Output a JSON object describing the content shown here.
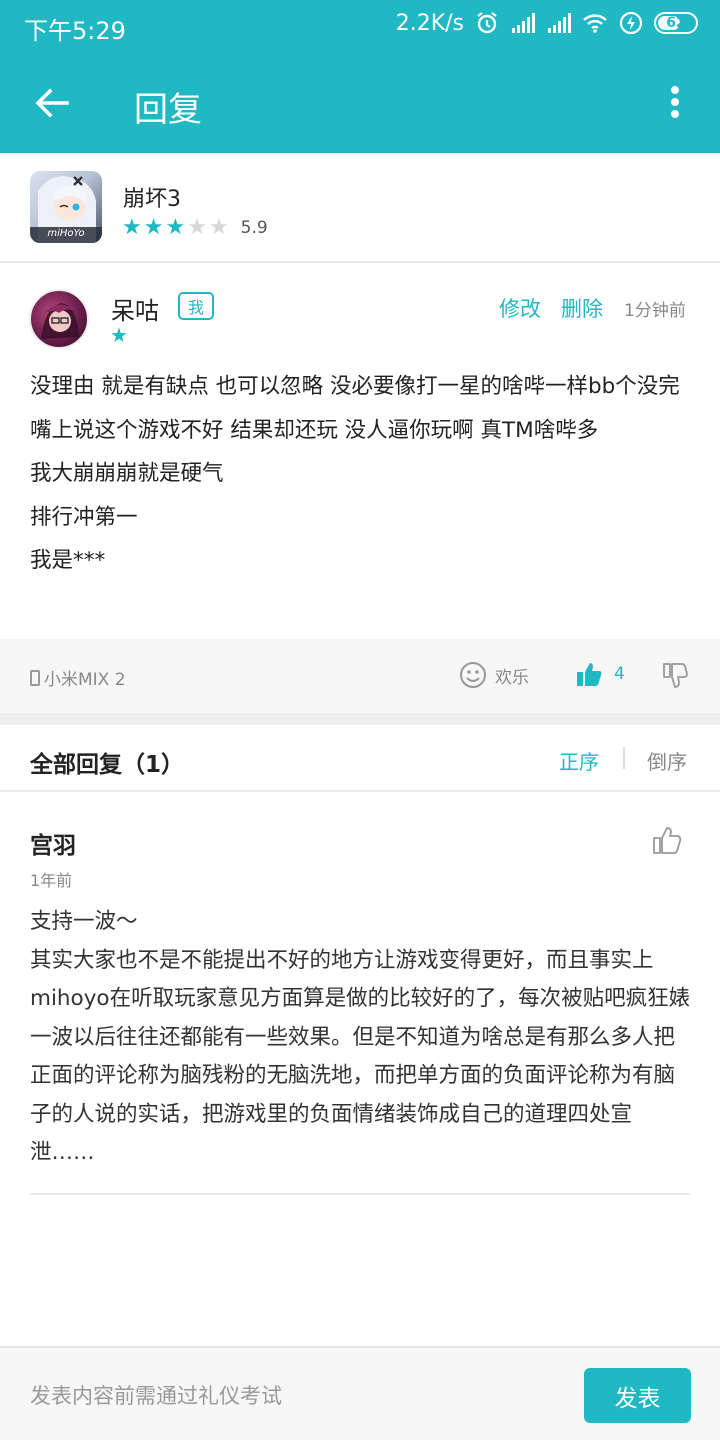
{
  "status_bar": {
    "time": "下午5:29",
    "net_speed": "2.2K/s",
    "battery": "62",
    "battery_level": 0.62
  },
  "app_bar": {
    "title": "回复",
    "back_icon": "arrow-left-icon",
    "more_icon": "more-vertical-icon"
  },
  "game": {
    "name": "崩坏3",
    "icon_brand": "miHoYo",
    "rating": "5.9",
    "stars_filled": 3,
    "stars_total": 5
  },
  "review": {
    "username": "呆咕",
    "me_badge": "我",
    "user_stars": 1,
    "edit_label": "修改",
    "delete_label": "删除",
    "time_ago": "1分钟前",
    "text": "没理由 就是有缺点 也可以忽略 没必要像打一星的啥哔一样bb个没完 嘴上说这个游戏不好 结果却还玩 没人逼你玩啊 真TM啥哔多\n我大崩崩崩就是硬气\n排行冲第一\n我是***",
    "device": "小米MIX 2",
    "fun_label": "欢乐",
    "like_count": "4"
  },
  "replies": {
    "title": "全部回复（1）",
    "sort_asc": "正序",
    "sort_desc": "倒序",
    "items": [
      {
        "username": "宫羽",
        "time_ago": "1年前",
        "text": "支持一波～\n其实大家也不是不能提出不好的地方让游戏变得更好，而且事实上mihoyo在听取玩家意见方面算是做的比较好的了，每次被贴吧疯狂婊一波以后往往还都能有一些效果。但是不知道为啥总是有那么多人把正面的评论称为脑残粉的无脑洗地，而把单方面的负面评论称为有脑子的人说的实话，把游戏里的负面情绪装饰成自己的道理四处宣泄……"
      }
    ]
  },
  "compose": {
    "placeholder": "发表内容前需通过礼仪考试",
    "send_label": "发表"
  },
  "colors": {
    "accent": "#1fb8c3",
    "star_empty": "#d8d8d8",
    "muted_text": "#888888"
  }
}
